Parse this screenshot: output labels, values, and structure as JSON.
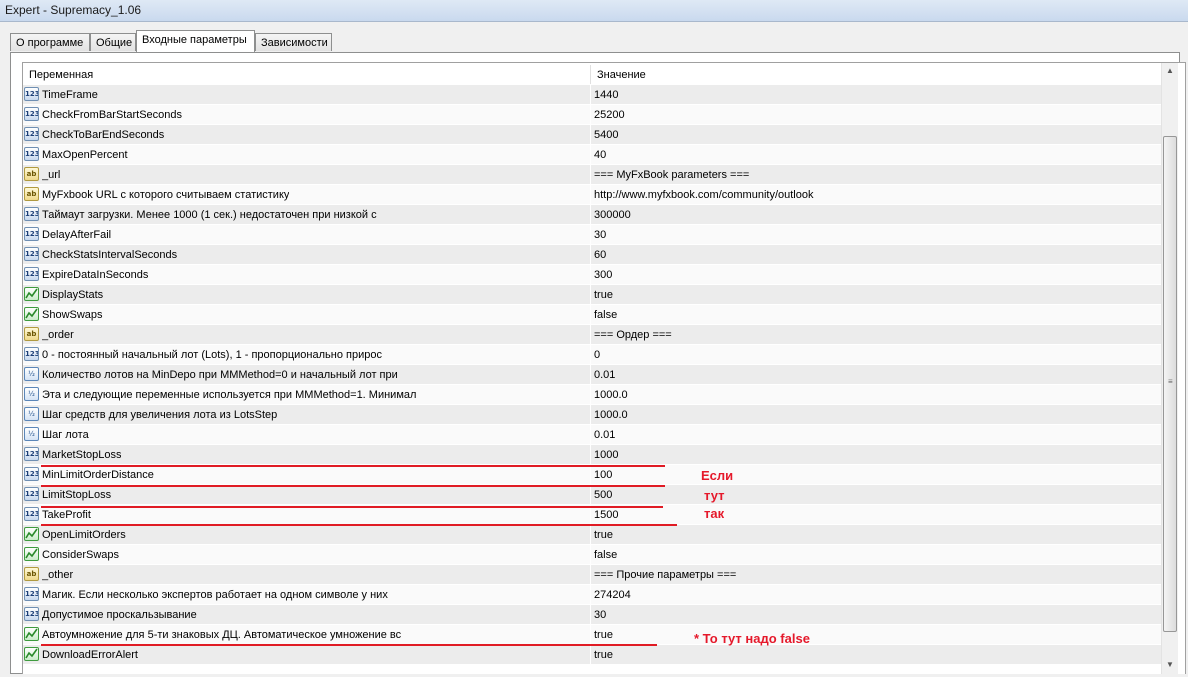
{
  "window": {
    "title": "Expert - Supremacy_1.06"
  },
  "tabs": [
    {
      "label": "О программе",
      "active": false
    },
    {
      "label": "Общие",
      "active": false
    },
    {
      "label": "Входные параметры",
      "active": true
    },
    {
      "label": "Зависимости",
      "active": false
    }
  ],
  "grid": {
    "columns": {
      "name": "Переменная",
      "value": "Значение"
    },
    "rows": [
      {
        "type": "int",
        "name": "TimeFrame",
        "value": "1440"
      },
      {
        "type": "int",
        "name": "CheckFromBarStartSeconds",
        "value": "25200"
      },
      {
        "type": "int",
        "name": "CheckToBarEndSeconds",
        "value": "5400"
      },
      {
        "type": "int",
        "name": "MaxOpenPercent",
        "value": "40"
      },
      {
        "type": "string",
        "name": "_url",
        "value": "=== MyFxBook parameters ==="
      },
      {
        "type": "string",
        "name": "MyFxbook URL с которого считываем статистику",
        "value": "http://www.myfxbook.com/community/outlook"
      },
      {
        "type": "int",
        "name": "Таймаут загрузки. Менее 1000 (1 сек.) недостаточен при низкой с",
        "value": "300000"
      },
      {
        "type": "int",
        "name": "DelayAfterFail",
        "value": "30"
      },
      {
        "type": "int",
        "name": "CheckStatsIntervalSeconds",
        "value": "60"
      },
      {
        "type": "int",
        "name": "ExpireDataInSeconds",
        "value": "300"
      },
      {
        "type": "bool",
        "name": "DisplayStats",
        "value": "true"
      },
      {
        "type": "bool",
        "name": "ShowSwaps",
        "value": "false"
      },
      {
        "type": "string",
        "name": "_order",
        "value": "=== Ордер ==="
      },
      {
        "type": "int",
        "name": "0 - постоянный начальный лот (Lots), 1 - пропорционально прирос",
        "value": "0"
      },
      {
        "type": "double",
        "name": "Количество лотов на MinDepo при MMMethod=0 и начальный лот при",
        "value": "0.01"
      },
      {
        "type": "double",
        "name": "Эта и следующие переменные используется при MMMethod=1. Минимал",
        "value": "1000.0"
      },
      {
        "type": "double",
        "name": "Шаг средств для увеличения лота из LotsStep",
        "value": "1000.0"
      },
      {
        "type": "double",
        "name": "Шаг лота",
        "value": "0.01"
      },
      {
        "type": "int",
        "name": "MarketStopLoss",
        "value": "1000"
      },
      {
        "type": "int",
        "name": "MinLimitOrderDistance",
        "value": "100"
      },
      {
        "type": "int",
        "name": "LimitStopLoss",
        "value": "500"
      },
      {
        "type": "int",
        "name": "TakeProfit",
        "value": "1500"
      },
      {
        "type": "bool",
        "name": "OpenLimitOrders",
        "value": "true"
      },
      {
        "type": "bool",
        "name": "ConsiderSwaps",
        "value": "false"
      },
      {
        "type": "string",
        "name": "_other",
        "value": "=== Прочие параметры ==="
      },
      {
        "type": "int",
        "name": "Магик. Если несколько экспертов работает на одном символе у них",
        "value": "274204"
      },
      {
        "type": "int",
        "name": "Допустимое проскальзывание",
        "value": "30"
      },
      {
        "type": "bool",
        "name": "Автоумножение для 5-ти знаковых ДЦ. Автоматическое умножение вс",
        "value": "true"
      },
      {
        "type": "bool",
        "name": "DownloadErrorAlert",
        "value": "true"
      }
    ]
  },
  "icons": {
    "int": "123",
    "string": "ab",
    "bool": "bool-icon",
    "double": "½"
  },
  "annotations": {
    "line1": "Если",
    "line2": "тут",
    "line3": "так",
    "note": "* То тут надо false",
    "color": "#e5192b"
  }
}
